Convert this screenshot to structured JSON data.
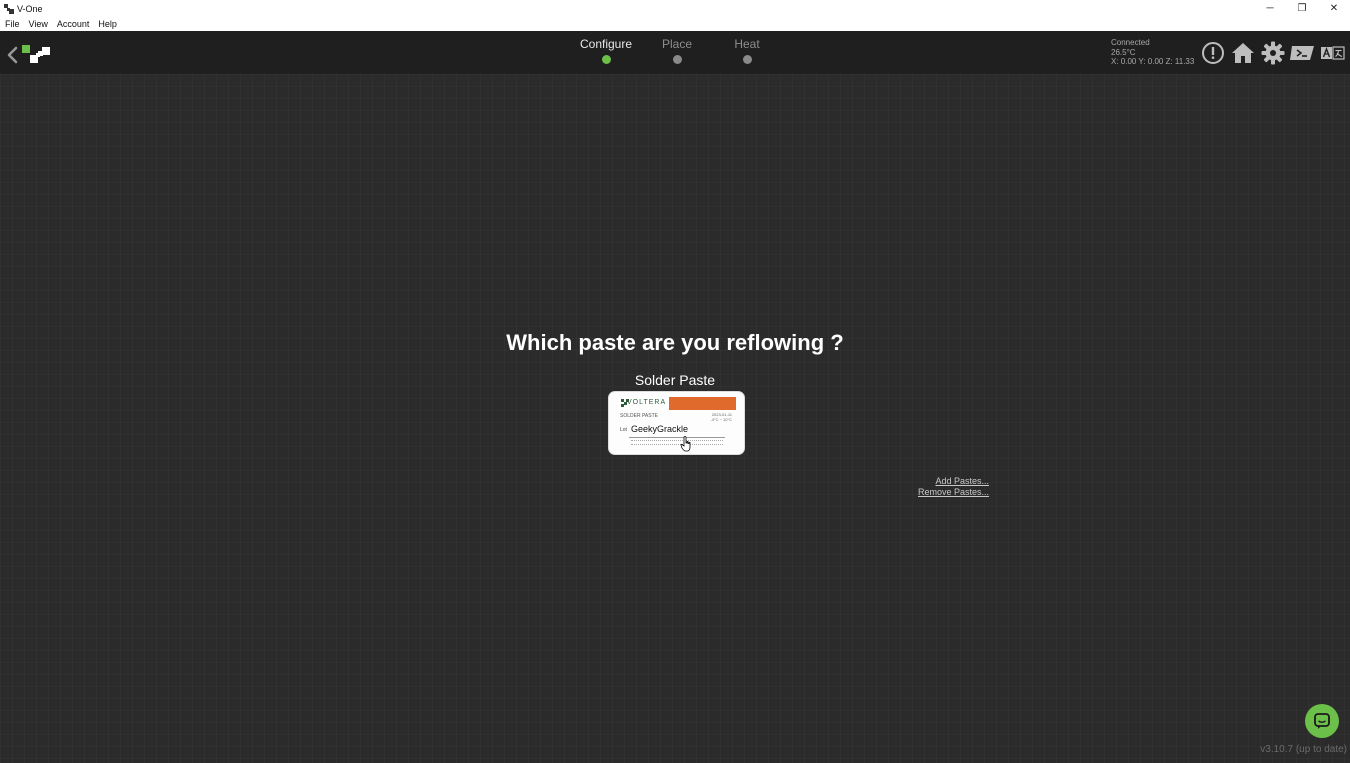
{
  "window": {
    "title": "V-One",
    "controls": {
      "minimize": "─",
      "maximize": "❐",
      "close": "✕"
    }
  },
  "menu": {
    "items": [
      "File",
      "View",
      "Account",
      "Help"
    ]
  },
  "toolbar": {
    "steps": [
      {
        "label": "Configure",
        "active": true
      },
      {
        "label": "Place",
        "active": false
      },
      {
        "label": "Heat",
        "active": false
      }
    ],
    "status": {
      "connection": "Connected",
      "temperature": "26.5°C",
      "position": "X: 0.00 Y: 0.00 Z: 11.33"
    },
    "icons": [
      "alert-icon",
      "home-icon",
      "gear-icon",
      "terminal-icon",
      "language-icon"
    ]
  },
  "main": {
    "question": "Which paste are you reflowing ?",
    "paste_label": "Solder Paste",
    "card": {
      "brand": "VOLTERA",
      "type": "SOLDER PASTE",
      "date_line": "2023-01-11",
      "temp_line": "-4°C ~ 10°C",
      "lot_label": "Lot",
      "lot": "GeekyGrackle"
    },
    "add_pastes": "Add Pastes...",
    "remove_pastes": "Remove Pastes..."
  },
  "footer": {
    "version": "v3.10.7 (up to date)"
  },
  "colors": {
    "accent": "#6cc04a",
    "brand_orange": "#e06a2b",
    "toolbar_bg": "#1f1f1f",
    "main_bg": "#2b2b2b"
  }
}
